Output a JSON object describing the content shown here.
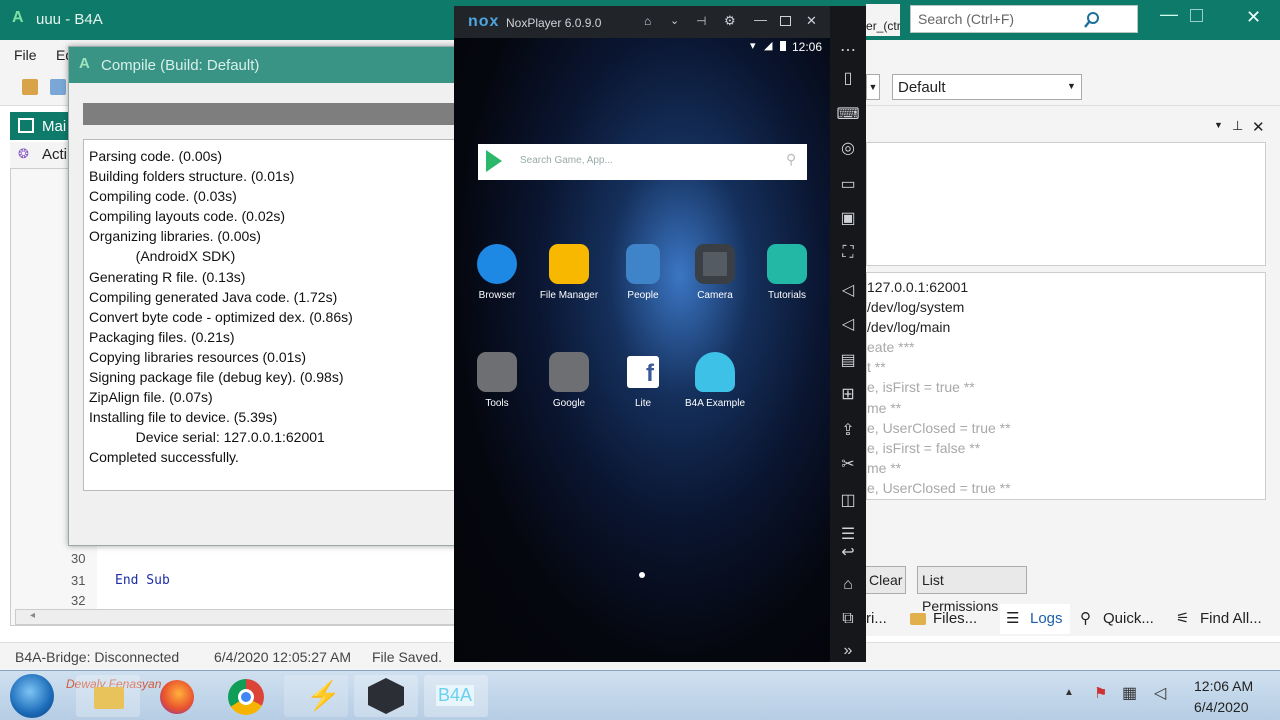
{
  "b4a": {
    "window_title": "uuu - B4A",
    "menu": [
      "File",
      "Ed"
    ],
    "tab_main": "Mai",
    "tab_activity": "Acti",
    "search_placeholder": "Search (Ctrl+F)",
    "designer_tab": "signer_(ctrl",
    "config_select": "Default",
    "code_lines": [
      {
        "num": "30",
        "text": ""
      },
      {
        "num": "31",
        "text": "End Sub"
      },
      {
        "num": "32",
        "text": ""
      }
    ],
    "logs": [
      "127.0.0.1:62001",
      "/dev/log/system",
      "/dev/log/main",
      "eate ***",
      "t **",
      "e, isFirst = true **",
      "me **",
      "e, UserClosed = true **",
      "e, isFirst = false **",
      "me **",
      "e, UserClosed = true **"
    ],
    "buttons": {
      "clear": "Clear",
      "list_permissions": "List Permissions"
    },
    "bottom_tabs": [
      "ri...",
      "Files...",
      "Logs",
      "Quick...",
      "Find All..."
    ],
    "status": {
      "bridge": "B4A-Bridge: Disconnected",
      "time": "6/4/2020 12:05:27 AM",
      "saved": "File Saved."
    }
  },
  "compile": {
    "title": "Compile (Build: Default)",
    "log": [
      "Parsing code.    (0.00s)",
      "Building folders structure.    (0.01s)",
      "Compiling code.    (0.03s)",
      "Compiling layouts code.    (0.02s)",
      "Organizing libraries.    (0.00s)",
      "            (AndroidX SDK)",
      "Generating R file.    (0.13s)",
      "Compiling generated Java code.    (1.72s)",
      "Convert byte code - optimized dex.    (0.86s)",
      "Packaging files.    (0.21s)",
      "Copying libraries resources    (0.01s)",
      "Signing package file (debug key).    (0.98s)",
      "ZipAlign file.    (0.07s)",
      "Installing file to device.    (5.39s)",
      "            Device serial: 127.0.0.1:62001",
      "Completed successfully."
    ]
  },
  "nox": {
    "logo": "nox",
    "title": "NoxPlayer 6.0.9.0",
    "clock": "12:06",
    "search_placeholder": "Search Game, App...",
    "apps_row1": [
      "Browser",
      "File Manager",
      "People",
      "Camera",
      "Tutorials"
    ],
    "apps_row2": [
      "Tools",
      "Google",
      "Lite",
      "B4A Example"
    ],
    "colors": {
      "browser": "#1e88e5",
      "files": "#f9b800",
      "people": "#3f83c8",
      "camera": "#555b63",
      "tutorials": "#22b8a5",
      "folder": "#6d6f73",
      "facebook": "#ffffff",
      "b4a": "#3ec1e6"
    }
  },
  "taskbar": {
    "watermark": "Dewaly Fenasyan",
    "b4a_label": "B4A",
    "clock_time": "12:06 AM",
    "clock_date": "6/4/2020"
  }
}
